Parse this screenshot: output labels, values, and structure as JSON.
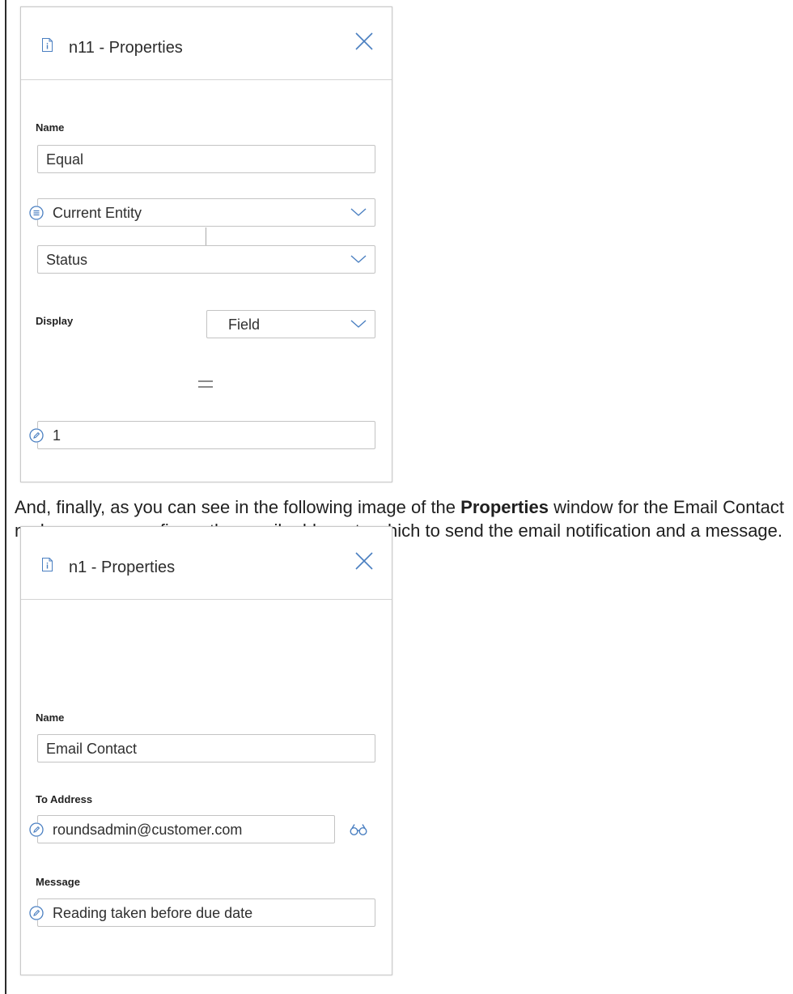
{
  "panel1": {
    "title": "n11 - Properties",
    "name_label": "Name",
    "name_value": "Equal",
    "entity_select": "Current Entity",
    "field_select": "Status",
    "display_label": "Display",
    "display_select": "Field",
    "compare_value": "1"
  },
  "paragraph": {
    "before": "And, finally, as you can see in the following image of the ",
    "bold": "Properties",
    "after": " window for the Email Contact node, you can configure the email address to which to send the email notification and a message."
  },
  "panel2": {
    "title": "n1 - Properties",
    "name_label": "Name",
    "name_value": "Email Contact",
    "to_label": "To Address",
    "to_value": "roundsadmin@customer.com",
    "message_label": "Message",
    "message_value": "Reading taken before due date"
  },
  "icons": {
    "document": "info-document-icon",
    "close": "close-icon",
    "list": "list-circle-icon",
    "chevron": "chevron-down-icon",
    "pencil": "pencil-circle-icon",
    "binoculars": "binoculars-icon"
  },
  "colors": {
    "icon_blue": "#4a7fc1",
    "border": "#c3c3c3"
  }
}
